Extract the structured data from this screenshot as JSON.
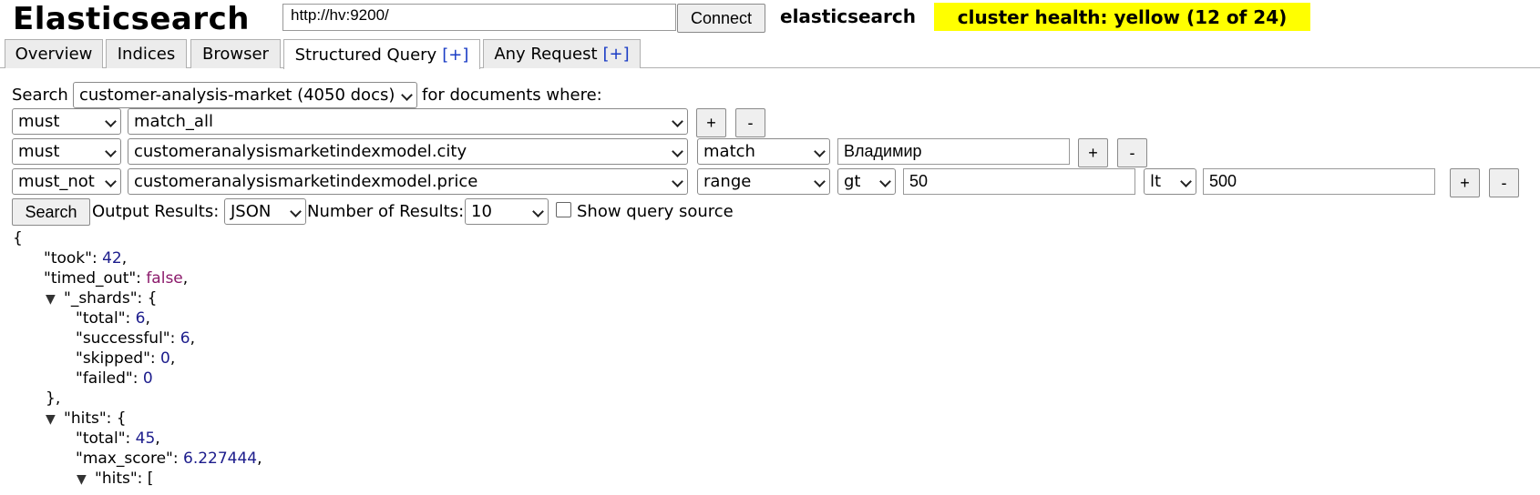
{
  "header": {
    "logo": "Elasticsearch",
    "url_value": "http://hv:9200/",
    "connect_label": "Connect",
    "cluster_name": "elasticsearch",
    "health_text": "cluster health: yellow (12 of 24)",
    "health_color": "#ffff00"
  },
  "tabs": [
    {
      "label": "Overview",
      "plus": ""
    },
    {
      "label": "Indices",
      "plus": ""
    },
    {
      "label": "Browser",
      "plus": ""
    },
    {
      "label": "Structured Query",
      "plus": "[+]",
      "active": true
    },
    {
      "label": "Any Request",
      "plus": "[+]"
    }
  ],
  "query": {
    "search_label": "Search",
    "index_selected": "customer-analysis-market (4050 docs)",
    "where_label": "for documents where:",
    "rows": [
      {
        "bool": "must",
        "field": "match_all"
      },
      {
        "bool": "must",
        "field": "customeranalysismarketindexmodel.city",
        "op": "match",
        "value": "Владимир"
      },
      {
        "bool": "must_not",
        "field": "customeranalysismarketindexmodel.price",
        "op": "range",
        "cmp1": "gt",
        "val1": "50",
        "cmp2": "lt",
        "val2": "500"
      }
    ],
    "add_label": "+",
    "remove_label": "-",
    "search_button": "Search",
    "output_label": "Output Results:",
    "output_selected": "JSON",
    "num_results_label": "Number of Results:",
    "num_results_selected": "10",
    "show_source_label": "Show query source"
  },
  "result": {
    "open_brace": "{",
    "took_key": "\"took\": ",
    "took_val": "42",
    "timed_out_key": "\"timed_out\": ",
    "timed_out_val": "false",
    "shards_key": "\"_shards\": {",
    "total_key": "\"total\": ",
    "total_val": "6",
    "successful_key": "\"successful\": ",
    "successful_val": "6",
    "skipped_key": "\"skipped\": ",
    "skipped_val": "0",
    "failed_key": "\"failed\": ",
    "failed_val": "0",
    "close_shards": "},",
    "hits_key": "\"hits\": {",
    "hits_total_key": "\"total\": ",
    "hits_total_val": "45",
    "max_score_key": "\"max_score\": ",
    "max_score_val": "6.227444",
    "inner_hits_key": "\"hits\": [",
    "comma": ","
  },
  "icons": {
    "caret": "chevron-down-icon",
    "collapse": "triangle-down-icon"
  }
}
